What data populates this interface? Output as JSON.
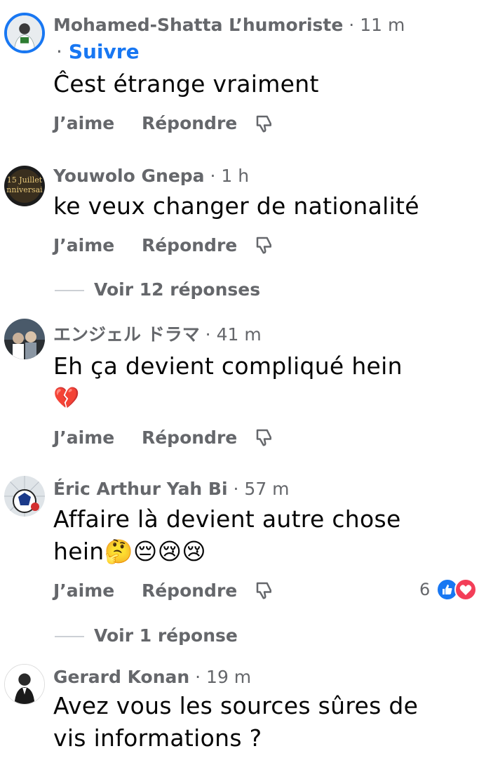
{
  "comments": [
    {
      "author": "Mohamed-Shatta L’humoriste",
      "time": "11 m",
      "follow": "Suivre",
      "text": "Ĉest étrange vraiment",
      "like": "J’aime",
      "reply": "Répondre"
    },
    {
      "author": "Youwolo Gnepa",
      "time": "1 h",
      "text": "ke veux changer de nationalité",
      "like": "J’aime",
      "reply": "Répondre",
      "view_replies": "Voir 12 réponses",
      "avatar_text_1": "15 Juillet",
      "avatar_text_2": "nniversai"
    },
    {
      "author": "エンジェル ドラマ",
      "time": "41 m",
      "text_line1": "Eh ça devient compliqué hein",
      "text_line2": "💔",
      "like": "J’aime",
      "reply": "Répondre"
    },
    {
      "author": "Éric Arthur Yah Bi",
      "time": "57 m",
      "text_line1": "Affaire là devient autre chose",
      "text_line2": "hein🤔😔😢😢",
      "like": "J’aime",
      "reply": "Répondre",
      "reaction_count": "6",
      "view_replies": "Voir 1 réponse"
    },
    {
      "author": "Gerard Konan",
      "time": "19 m",
      "text_line1": "Avez vous les sources sûres de",
      "text_line2": "vis informations ?"
    }
  ],
  "separator": "·",
  "colors": {
    "secondary_text": "#65676b",
    "primary_text": "#050505",
    "link_blue": "#1877f2",
    "like_blue": "#1877f2",
    "love_red": "#f33e58"
  }
}
